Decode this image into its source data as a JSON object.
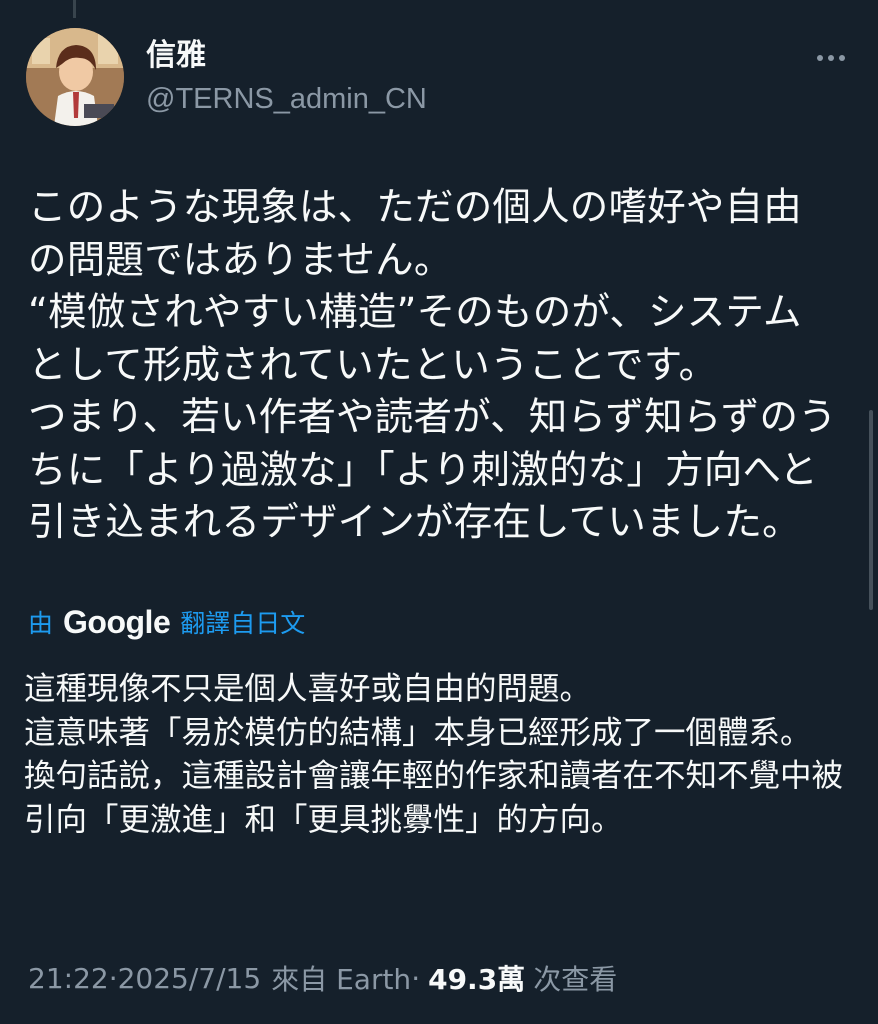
{
  "author": {
    "display_name": "信雅",
    "handle": "@TERNS_admin_CN"
  },
  "post": {
    "text": "このような現象は、ただの個人の嗜好や自由の問題ではありません。\n“模倣されやすい構造”そのものが、システムとして形成されていたということです。\nつまり、若い作者や読者が、知らず知らずのうちに「より過激な」「より刺激的な」方向へと引き込まれるデザインが存在していました。"
  },
  "translation": {
    "prefix": "由",
    "provider": "Google",
    "suffix": "翻譯自日文",
    "text": "這種現像不只是個人喜好或自由的問題。\n這意味著「易於模仿的結構」本身已經形成了一個體系。\n換句話說，這種設計會讓年輕的作家和讀者在不知不覺中被引向「更激進」和「更具挑釁性」的方向。"
  },
  "meta": {
    "time": "21:22",
    "sep1": " · ",
    "date": "2025/7/15",
    "source": "來自 Earth",
    "sep2": " · ",
    "views": "49.3萬",
    "views_label": "次查看"
  },
  "icons": {
    "more": "more-horizontal-icon",
    "avatar": "avatar-image"
  },
  "colors": {
    "background": "#15202b",
    "text_primary": "#f7f9f9",
    "text_secondary": "#8b98a5",
    "link": "#1d9bf0"
  }
}
